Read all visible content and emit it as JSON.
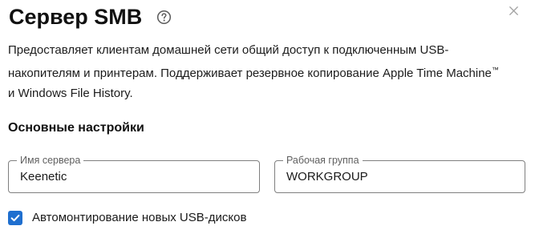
{
  "dialog": {
    "title": "Сервер SMB",
    "help_icon": "question-circle-icon",
    "close_icon": "close-icon",
    "description_line1": "Предоставляет клиентам домашней сети общий доступ к подключенным USB-",
    "description_line2": "накопителям и принтерам. Поддерживает резервное копирование Apple Time Machine",
    "description_tm": "™",
    "description_line3": "и Windows File History."
  },
  "settings": {
    "section_title": "Основные настройки",
    "server_name": {
      "label": "Имя сервера",
      "value": "Keenetic"
    },
    "workgroup": {
      "label": "Рабочая группа",
      "value": "WORKGROUP"
    },
    "automount": {
      "label": "Автомонтирование новых USB-дисков",
      "checked": true,
      "icon": "check-icon"
    }
  },
  "colors": {
    "accent": "#1f6fcf",
    "field_border": "#7f7f7f",
    "label_gray": "#5f5f5f"
  }
}
